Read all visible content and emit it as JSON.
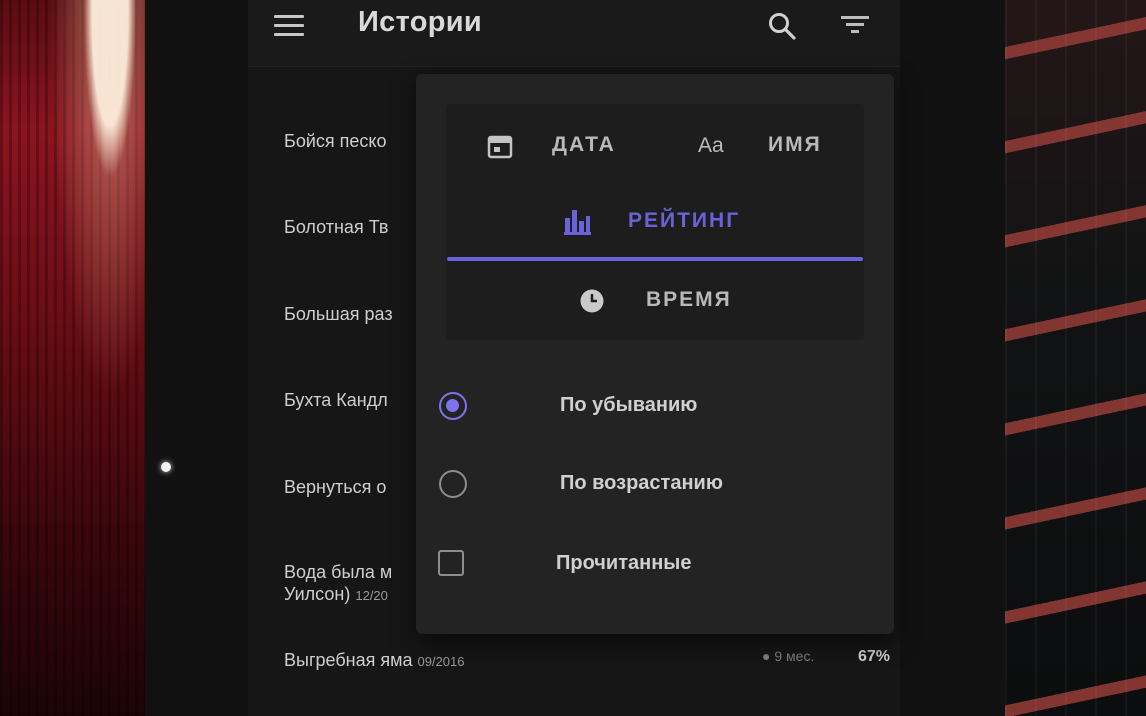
{
  "app_bar": {
    "title": "Истории",
    "menu_icon": "hamburger-menu-icon",
    "search_icon": "search-icon",
    "filter_icon": "filter-icon"
  },
  "stories": [
    {
      "title": "Бойся песко",
      "date": ""
    },
    {
      "title": "Болотная Тв",
      "date": ""
    },
    {
      "title": "Большая раз",
      "date": ""
    },
    {
      "title": "Бухта Кандл",
      "date": ""
    },
    {
      "title": "Вернуться о",
      "date": ""
    },
    {
      "title": "Вода была м",
      "line2": "Уилсон)",
      "date": "12/20"
    },
    {
      "title": "Выгребная яма",
      "date": "09/2016",
      "age": "9 мес.",
      "percent": "67%"
    }
  ],
  "sort_menu": {
    "options": [
      {
        "label": "ДАТА",
        "icon": "calendar-icon"
      },
      {
        "label": "ИМЯ",
        "icon": "text-aa-icon",
        "icon_text": "Aa"
      },
      {
        "label": "РЕЙТИНГ",
        "icon": "bar-chart-icon",
        "selected": true
      },
      {
        "label": "ВРЕМЯ",
        "icon": "clock-icon"
      }
    ],
    "order": [
      {
        "label": "По убыванию",
        "checked": true
      },
      {
        "label": "По возрастанию",
        "checked": false
      }
    ],
    "read_filter": {
      "label": "Прочитанные",
      "checked": false
    }
  },
  "colors": {
    "accent": "#6b62d8",
    "popup_bg": "#232324",
    "app_bg": "#161617"
  }
}
